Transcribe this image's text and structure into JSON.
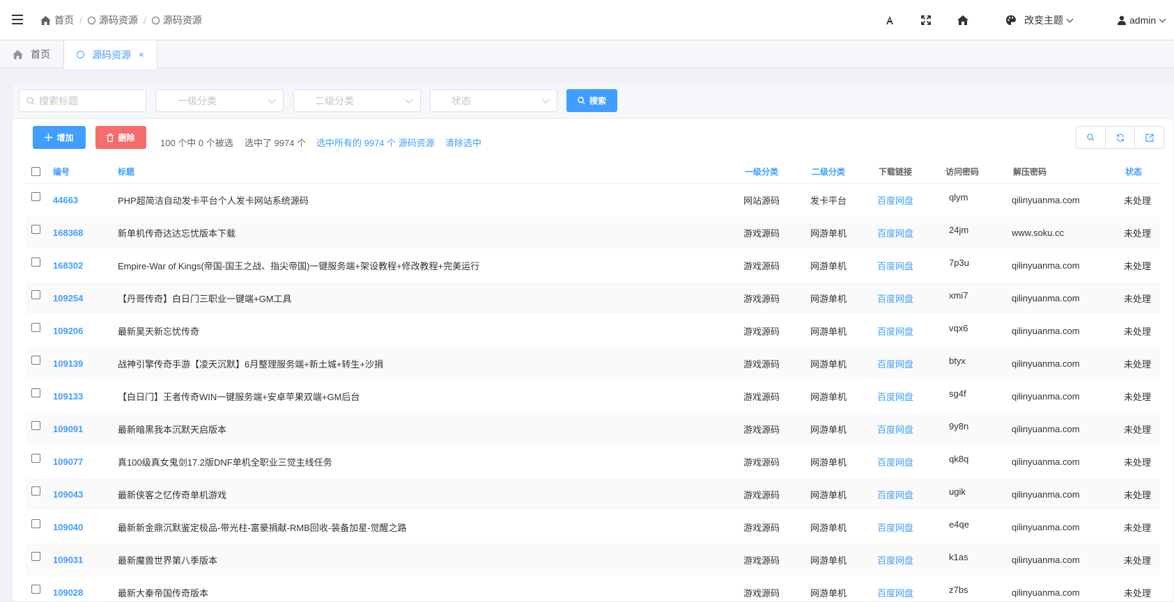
{
  "header": {
    "breadcrumb": [
      "首页",
      "源码资源",
      "源码资源"
    ],
    "user": "admin",
    "theme_label": "改变主题"
  },
  "tabs": [
    {
      "label": "首页"
    },
    {
      "label": "源码资源",
      "close": "×"
    }
  ],
  "filters": {
    "search_placeholder": "搜索标题",
    "cat1_placeholder": "一级分类",
    "cat2_placeholder": "二级分类",
    "status_placeholder": "状态",
    "search_button": "搜索"
  },
  "toolbar": {
    "add_label": "增加",
    "delete_label": "删除",
    "selection_text": "100 个中 0 个被选",
    "selected_count_text": "选中了 9974 个",
    "select_all_link": "选中所有的 9974 个 源码资源",
    "clear_link": "清除选中"
  },
  "table": {
    "columns": [
      "编号",
      "标题",
      "一级分类",
      "二级分类",
      "下载链接",
      "访问密码",
      "解压密码",
      "状态"
    ],
    "rows": [
      {
        "id": "44663",
        "title": "PHP超简洁自动发卡平台个人发卡网站系统源码",
        "cat1": "网站源码",
        "cat2": "发卡平台",
        "link": "百度网盘",
        "pwd": "qlym",
        "unzip": "qilinyuanma.com",
        "status": "未处理"
      },
      {
        "id": "168368",
        "title": "新单机传奇达达忘忧版本下载",
        "cat1": "游戏源码",
        "cat2": "网游单机",
        "link": "百度网盘",
        "pwd": "24jm",
        "unzip": "www.soku.cc",
        "status": "未处理"
      },
      {
        "id": "168302",
        "title": "Empire-War of Kings(帝国-国王之战、指尖帝国)一键服务端+架设教程+修改教程+完美运行",
        "cat1": "游戏源码",
        "cat2": "网游单机",
        "link": "百度网盘",
        "pwd": "7p3u",
        "unzip": "qilinyuanma.com",
        "status": "未处理"
      },
      {
        "id": "109254",
        "title": "【丹哥传奇】白日门三职业一键端+GM工具",
        "cat1": "游戏源码",
        "cat2": "网游单机",
        "link": "百度网盘",
        "pwd": "xmi7",
        "unzip": "qilinyuanma.com",
        "status": "未处理"
      },
      {
        "id": "109206",
        "title": "最新昊天新忘忧传奇",
        "cat1": "游戏源码",
        "cat2": "网游单机",
        "link": "百度网盘",
        "pwd": "vqx6",
        "unzip": "qilinyuanma.com",
        "status": "未处理"
      },
      {
        "id": "109139",
        "title": "战神引擎传奇手游【凌天沉默】6月整理服务端+新土城+转生+沙捐",
        "cat1": "游戏源码",
        "cat2": "网游单机",
        "link": "百度网盘",
        "pwd": "btyx",
        "unzip": "qilinyuanma.com",
        "status": "未处理"
      },
      {
        "id": "109133",
        "title": "【白日门】王者传奇WIN一键服务端+安卓苹果双端+GM后台",
        "cat1": "游戏源码",
        "cat2": "网游单机",
        "link": "百度网盘",
        "pwd": "sg4f",
        "unzip": "qilinyuanma.com",
        "status": "未处理"
      },
      {
        "id": "109091",
        "title": "最新暗黑我本沉默天启版本",
        "cat1": "游戏源码",
        "cat2": "网游单机",
        "link": "百度网盘",
        "pwd": "9y8n",
        "unzip": "qilinyuanma.com",
        "status": "未处理"
      },
      {
        "id": "109077",
        "title": "真100级真女鬼剑17.2版DNF单机全职业三觉主线任务",
        "cat1": "游戏源码",
        "cat2": "网游单机",
        "link": "百度网盘",
        "pwd": "qk8q",
        "unzip": "qilinyuanma.com",
        "status": "未处理"
      },
      {
        "id": "109043",
        "title": "最新侠客之忆传奇单机游戏",
        "cat1": "游戏源码",
        "cat2": "网游单机",
        "link": "百度网盘",
        "pwd": "ugik",
        "unzip": "qilinyuanma.com",
        "status": "未处理"
      },
      {
        "id": "109040",
        "title": "最新新金鼎沉默鉴定极品-带光柱-富豪捐献-RMB回收-装备加星-觉醒之路",
        "cat1": "游戏源码",
        "cat2": "网游单机",
        "link": "百度网盘",
        "pwd": "e4qe",
        "unzip": "qilinyuanma.com",
        "status": "未处理"
      },
      {
        "id": "109031",
        "title": "最新魔兽世界第八季版本",
        "cat1": "游戏源码",
        "cat2": "网游单机",
        "link": "百度网盘",
        "pwd": "k1as",
        "unzip": "qilinyuanma.com",
        "status": "未处理"
      },
      {
        "id": "109028",
        "title": "最新大秦帝国传奇版本",
        "cat1": "游戏源码",
        "cat2": "网游单机",
        "link": "百度网盘",
        "pwd": "z7bs",
        "unzip": "qilinyuanma.com",
        "status": "未处理"
      }
    ]
  },
  "colors": {
    "accent": "#409eff",
    "danger": "#f56c6c"
  }
}
